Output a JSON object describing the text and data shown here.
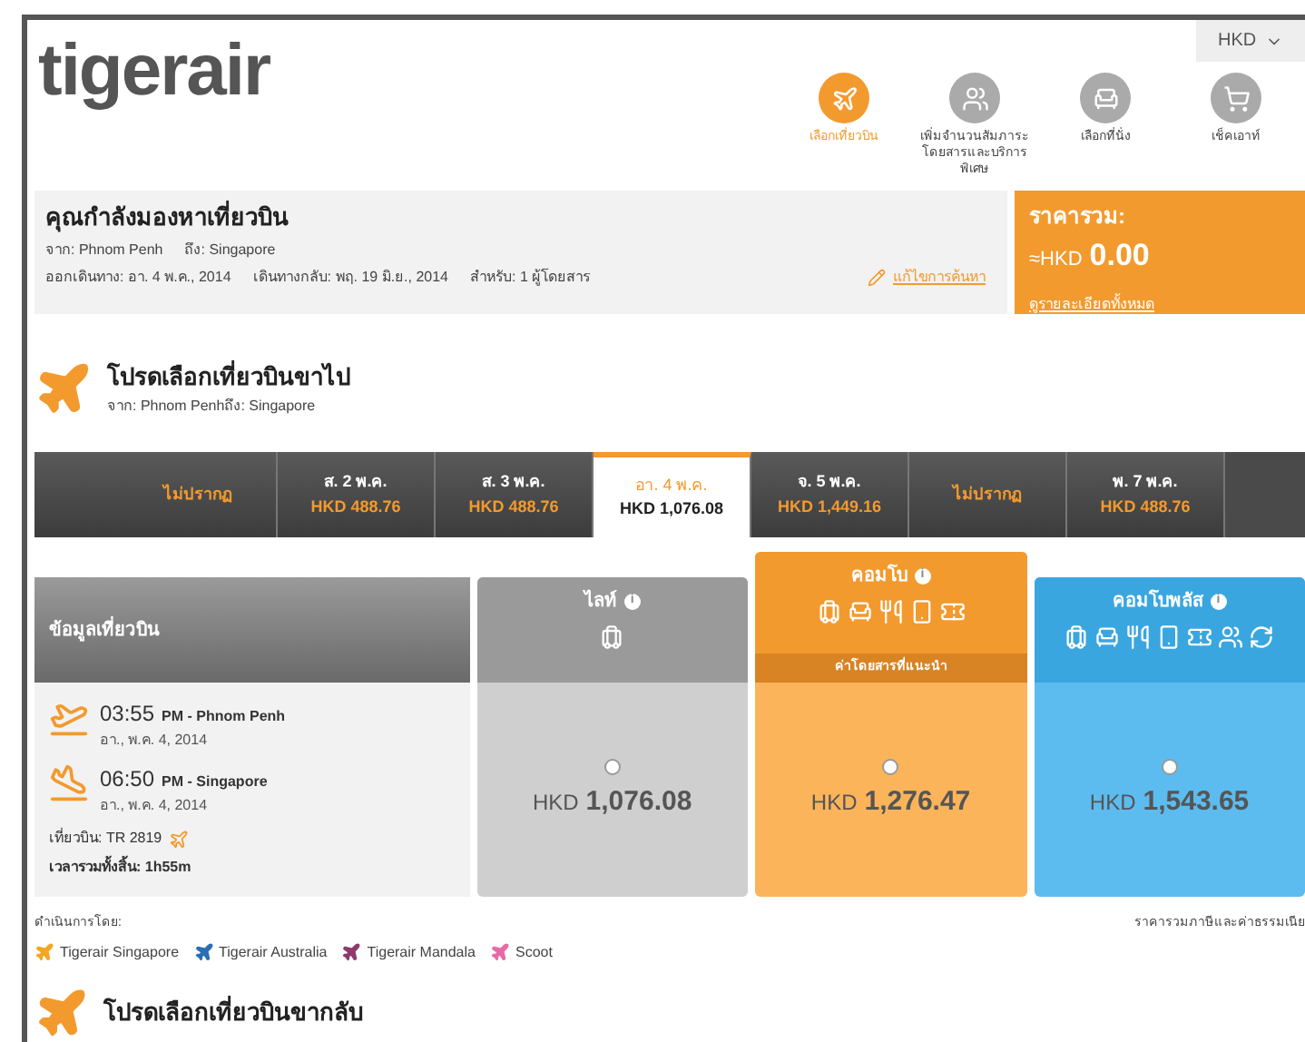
{
  "currency_selector": {
    "value": "HKD"
  },
  "logo": "tigerair",
  "steps": [
    {
      "label": "เลือกเที่ยวบิน",
      "selected": true,
      "kind": "plane"
    },
    {
      "label": "เพิ่มจำนวนสัมภาระ โดยสารและบริการพิเศษ",
      "selected": false,
      "kind": "people"
    },
    {
      "label": "เลือกที่นั่ง",
      "selected": false,
      "kind": "seat"
    },
    {
      "label": "เช็คเอาท์",
      "selected": false,
      "kind": "cart"
    }
  ],
  "search_summary": {
    "title": "คุณกำลังมองหาเที่ยวบิน",
    "from_label": "จาก:",
    "from": "Phnom Penh",
    "to_label": "ถึง:",
    "to": "Singapore",
    "depart_label": "ออกเดินทาง:",
    "depart": "อา. 4 พ.ค., 2014",
    "return_label": "เดินทางกลับ:",
    "return": "พฤ. 19 มิ.ย., 2014",
    "pax_label": "สำหรับ:",
    "pax": "1 ผู้โดยสาร",
    "edit_link": "แก้ไขการค้นหา"
  },
  "total": {
    "label": "ราคารวม:",
    "currency": "≈HKD",
    "amount": "0.00",
    "details_link": "ดูรายละเอียดทั้งหมด"
  },
  "outbound": {
    "title": "โปรดเลือกเที่ยวบินขาไป",
    "route": "จาก: Phnom Penhถึง: Singapore"
  },
  "date_tabs": [
    {
      "date": "ไม่ปรากฏ",
      "selected": false
    },
    {
      "date": "ส. 2 พ.ค.",
      "price": "HKD 488.76",
      "selected": false
    },
    {
      "date": "ส. 3 พ.ค.",
      "price": "HKD 488.76",
      "selected": false
    },
    {
      "date": "อา. 4 พ.ค.",
      "price": "HKD 1,076.08",
      "selected": true
    },
    {
      "date": "จ. 5 พ.ค.",
      "price": "HKD 1,449.16",
      "selected": false
    },
    {
      "date": "ไม่ปรากฏ",
      "selected": false
    },
    {
      "date": "พ. 7 พ.ค.",
      "price": "HKD 488.76",
      "selected": false
    }
  ],
  "flight_info": {
    "header": "ข้อมูลเที่ยวบิน",
    "legs": [
      {
        "kind": "depart",
        "time": "03:55",
        "ampm": "PM",
        "place": "- Phnom Penh",
        "date": "อา., พ.ค. 4, 2014"
      },
      {
        "kind": "arrive",
        "time": "06:50",
        "ampm": "PM",
        "place": "- Singapore",
        "date": "อา., พ.ค. 4, 2014"
      }
    ],
    "flight_no": "เที่ยวบิน: TR 2819",
    "duration": "เวลารวมทั้งสิ้น: 1h55m"
  },
  "fares": [
    {
      "kind": "lite",
      "name": "ไลท์",
      "info": "i",
      "icons": [
        {
          "kind": "bag"
        }
      ],
      "currency": "HKD",
      "amount": "1,076.08",
      "selected": false
    },
    {
      "kind": "combo",
      "name": "คอมโบ",
      "info": "i",
      "icons": [
        {
          "kind": "bag"
        },
        {
          "kind": "seat"
        },
        {
          "kind": "meal"
        },
        {
          "kind": "phone"
        },
        {
          "kind": "ticket"
        }
      ],
      "recommended": "ค่าโดยสารที่แนะนำ",
      "currency": "HKD",
      "amount": "1,276.47",
      "selected": false
    },
    {
      "kind": "comboplus",
      "name": "คอมโบพลัส",
      "info": "i",
      "icons": [
        {
          "kind": "bag"
        },
        {
          "kind": "seat"
        },
        {
          "kind": "meal"
        },
        {
          "kind": "phone"
        },
        {
          "kind": "ticket"
        },
        {
          "kind": "people"
        },
        {
          "kind": "change"
        }
      ],
      "currency": "HKD",
      "amount": "1,543.65",
      "selected": false
    }
  ],
  "operated_by": {
    "label": "ดำเนินการโดย:",
    "carriers": [
      {
        "name": "Tigerair Singapore",
        "color": "#f5a623"
      },
      {
        "name": "Tigerair Australia",
        "color": "#2a6fb5"
      },
      {
        "name": "Tigerair Mandala",
        "color": "#8e3a6e"
      },
      {
        "name": "Scoot",
        "color": "#e86aa6"
      }
    ]
  },
  "price_note": "ราคารวมภาษีและค่าธรรมเนีย",
  "return": {
    "title": "โปรดเลือกเที่ยวบินขากลับ"
  }
}
